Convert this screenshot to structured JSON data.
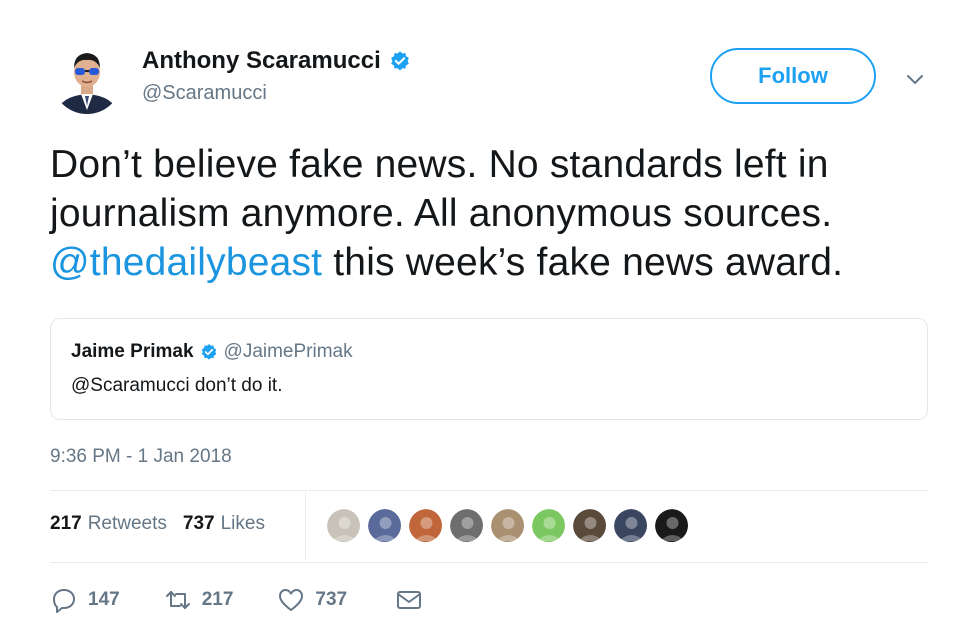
{
  "author": {
    "name": "Anthony Scaramucci",
    "handle": "@Scaramucci",
    "avatar_icon": "user-avatar",
    "verified": true
  },
  "follow_label": "Follow",
  "tweet": {
    "text_before": "Don’t believe fake news. No standards left in journalism anymore. All anonymous sources. ",
    "mention": "@thedailybeast",
    "text_after": " this week’s fake news award."
  },
  "quoted": {
    "name": "Jaime Primak",
    "handle": "@JaimePrimak",
    "text": "@Scaramucci don’t do it."
  },
  "timestamp": "9:36 PM - 1 Jan 2018",
  "stats": {
    "retweets_count": "217",
    "retweets_label": "Retweets",
    "likes_count": "737",
    "likes_label": "Likes"
  },
  "likers": [
    {
      "icon": "liker-avatar",
      "color": "#c8c2b8"
    },
    {
      "icon": "liker-avatar",
      "color": "#5a6a9a"
    },
    {
      "icon": "liker-avatar",
      "color": "#c0663a"
    },
    {
      "icon": "liker-avatar",
      "color": "#6e6e6e"
    },
    {
      "icon": "liker-avatar",
      "color": "#a89070"
    },
    {
      "icon": "liker-avatar",
      "color": "#7cc860"
    },
    {
      "icon": "liker-avatar",
      "color": "#5a4a3a"
    },
    {
      "icon": "liker-avatar",
      "color": "#3a4660"
    },
    {
      "icon": "liker-avatar",
      "color": "#1a1a1a"
    }
  ],
  "actions": {
    "reply_count": "147",
    "retweet_count": "217",
    "like_count": "737"
  },
  "colors": {
    "accent": "#1da1f2",
    "link": "#1b95e0",
    "muted": "#657786",
    "text": "#14171a"
  }
}
